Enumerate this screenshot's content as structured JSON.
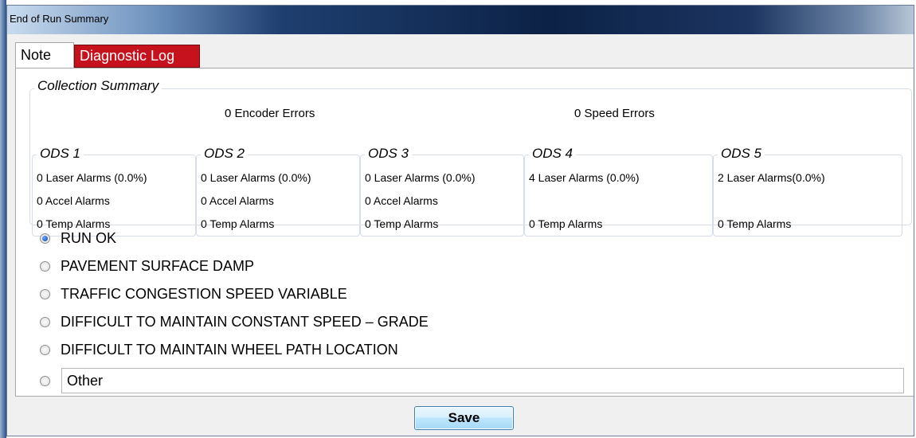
{
  "window": {
    "title": "End of Run Summary"
  },
  "tabs": [
    {
      "label": "Note"
    },
    {
      "label": "Diagnostic Log"
    }
  ],
  "summary": {
    "legend": "Collection Summary",
    "encoder_errors": "0 Encoder Errors",
    "speed_errors": "0 Speed Errors",
    "ods": [
      {
        "title": "ODS 1",
        "laser": "0 Laser Alarms (0.0%)",
        "accel": "0 Accel Alarms",
        "temp": "0 Temp Alarms"
      },
      {
        "title": "ODS 2",
        "laser": "0 Laser Alarms (0.0%)",
        "accel": "0 Accel Alarms",
        "temp": "0 Temp Alarms"
      },
      {
        "title": "ODS 3",
        "laser": "0 Laser Alarms (0.0%)",
        "accel": "0 Accel Alarms",
        "temp": "0 Temp Alarms"
      },
      {
        "title": "ODS 4",
        "laser": "4 Laser Alarms (0.0%)",
        "accel": "",
        "temp": "0 Temp Alarms"
      },
      {
        "title": "ODS 5",
        "laser": "2 Laser Alarms(0.0%)",
        "accel": "",
        "temp": "0 Temp Alarms"
      }
    ]
  },
  "options": [
    {
      "label": "RUN OK",
      "checked": true
    },
    {
      "label": "PAVEMENT SURFACE DAMP",
      "checked": false
    },
    {
      "label": "TRAFFIC CONGESTION SPEED VARIABLE",
      "checked": false
    },
    {
      "label": "DIFFICULT TO MAINTAIN CONSTANT SPEED – GRADE",
      "checked": false
    },
    {
      "label": "DIFFICULT TO MAINTAIN WHEEL PATH LOCATION",
      "checked": false
    }
  ],
  "other": {
    "value": "Other"
  },
  "save_label": "Save",
  "colors": {
    "accent": "#c5121d",
    "title_bar": "#0c2246"
  }
}
